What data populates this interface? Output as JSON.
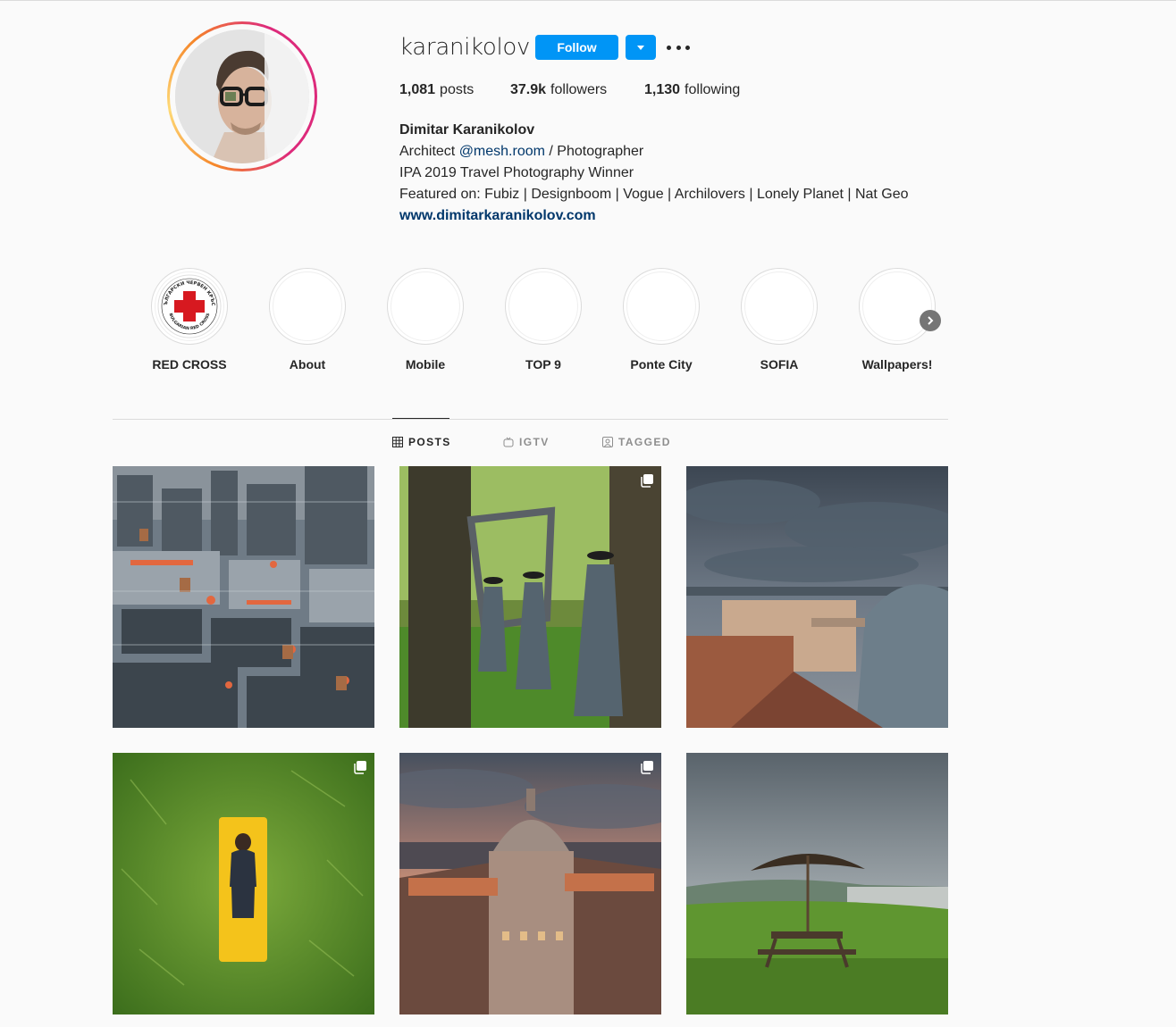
{
  "profile": {
    "username": "karanikolov",
    "follow_label": "Follow",
    "stats": {
      "posts_count": "1,081",
      "posts_label": "posts",
      "followers_count": "37.9k",
      "followers_label": "followers",
      "following_count": "1,130",
      "following_label": "following"
    },
    "bio": {
      "full_name": "Dimitar Karanikolov",
      "line1_prefix": "Architect ",
      "line1_mention": "@mesh.room",
      "line1_suffix": " / Photographer",
      "line2": "IPA 2019 Travel Photography Winner",
      "line3": "Featured on: Fubiz | Designboom | Vogue | Archilovers | Lonely Planet | Nat Geo",
      "website": "www.dimitarkaranikolov.com"
    }
  },
  "highlights": [
    {
      "label": "RED CROSS"
    },
    {
      "label": "About"
    },
    {
      "label": "Mobile"
    },
    {
      "label": "TOP 9"
    },
    {
      "label": "Ponte City"
    },
    {
      "label": "SOFIA"
    },
    {
      "label": "Wallpapers!"
    }
  ],
  "red_cross_badge": {
    "top_text": "БЪЛГАРСКИ ЧЕРВЕН КРЪСТ",
    "bottom_text": "BULGARIAN RED CROSS"
  },
  "tabs": [
    {
      "label": "POSTS",
      "icon": "grid-icon",
      "active": true
    },
    {
      "label": "IGTV",
      "icon": "igtv-icon",
      "active": false
    },
    {
      "label": "TAGGED",
      "icon": "tagged-icon",
      "active": false
    }
  ],
  "posts": [
    {
      "subject": "city rooftops with water towers",
      "multi": false
    },
    {
      "subject": "figures in cloaks in a forest",
      "multi": true
    },
    {
      "subject": "stormy sky over city domes",
      "multi": false
    },
    {
      "subject": "woman on yellow mat in grass",
      "multi": true
    },
    {
      "subject": "domed building at sunset",
      "multi": true
    },
    {
      "subject": "umbrella and picnic table by the sea",
      "multi": false
    }
  ],
  "colors": {
    "accent": "#0095f6",
    "background": "#fafafa",
    "text": "#262626",
    "muted": "#8e8e8e",
    "link": "#00376b"
  }
}
